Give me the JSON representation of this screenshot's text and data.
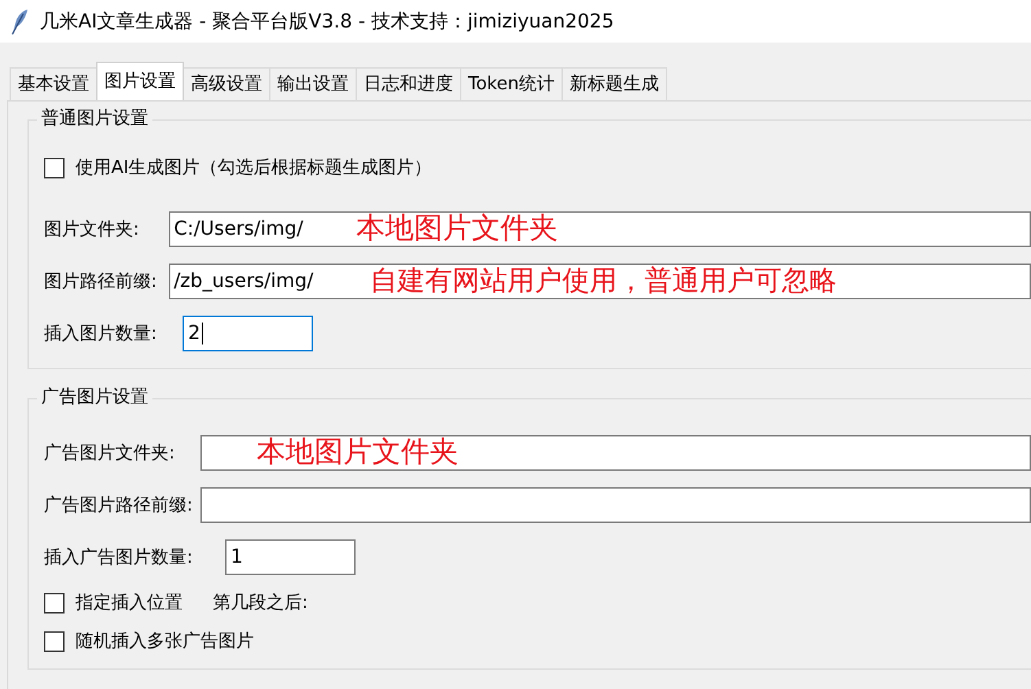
{
  "window": {
    "title": "几米AI文章生成器 - 聚合平台版V3.8 - 技术支持：jimiziyuan2025"
  },
  "tabs": [
    {
      "label": "基本设置",
      "selected": false
    },
    {
      "label": "图片设置",
      "selected": true
    },
    {
      "label": "高级设置",
      "selected": false
    },
    {
      "label": "输出设置",
      "selected": false
    },
    {
      "label": "日志和进度",
      "selected": false
    },
    {
      "label": "Token统计",
      "selected": false
    },
    {
      "label": "新标题生成",
      "selected": false
    }
  ],
  "groups": [
    {
      "title": "普通图片设置",
      "rows": [
        {
          "kind": "checkbox",
          "label": "使用AI生成图片（勾选后根据标题生成图片）",
          "checked": false
        },
        {
          "kind": "field",
          "label": "图片文件夹:",
          "value": "C:/Users/img/",
          "annotation": "本地图片文件夹",
          "focused": false
        },
        {
          "kind": "field",
          "label": "图片路径前缀:",
          "value": "/zb_users/img/",
          "annotation": "自建有网站用户使用，普通用户可忽略",
          "focused": false
        },
        {
          "kind": "number",
          "label": "插入图片数量:",
          "value": "2",
          "focused": true
        }
      ]
    },
    {
      "title": "广告图片设置",
      "rows": [
        {
          "kind": "field",
          "label": "广告图片文件夹:",
          "annotation": "本地图片文件夹",
          "focused": false
        },
        {
          "kind": "field",
          "label": "广告图片路径前缀:",
          "focused": false
        },
        {
          "kind": "number",
          "label": "插入广告图片数量:",
          "value": "1",
          "focused": false
        },
        {
          "kind": "checkbox",
          "label": "指定插入位置",
          "checked": false,
          "note": "第几段之后:"
        },
        {
          "kind": "checkbox",
          "label": "随机插入多张广告图片",
          "checked": false
        }
      ]
    }
  ]
}
